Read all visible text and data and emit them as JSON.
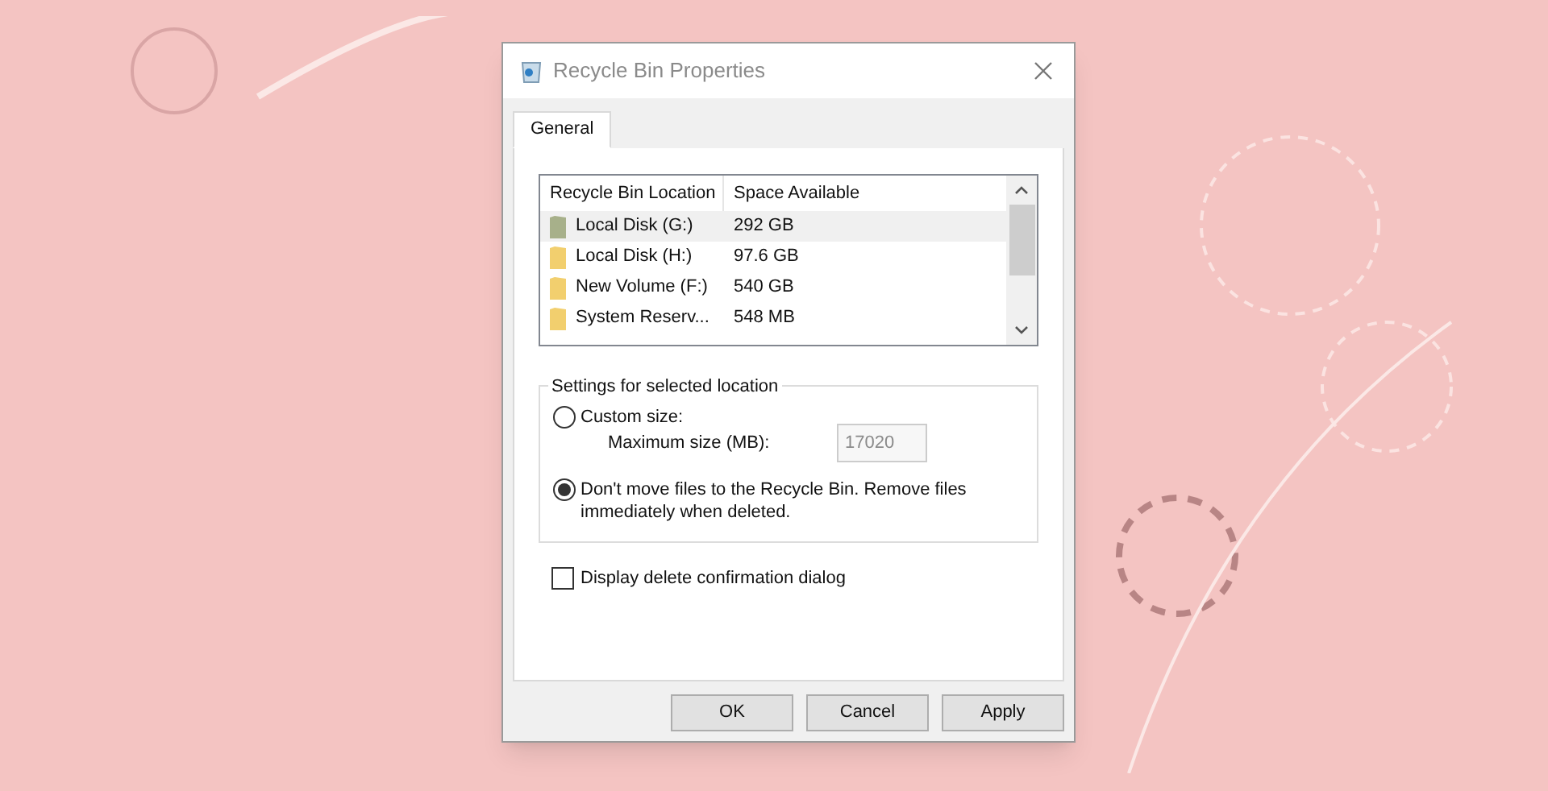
{
  "window": {
    "title": "Recycle Bin Properties"
  },
  "tabs": [
    {
      "label": "General",
      "selected": true
    }
  ],
  "locations": {
    "columns": [
      "Recycle Bin Location",
      "Space Available"
    ],
    "rows": [
      {
        "location": "Local Disk (G:)",
        "space": "292 GB",
        "selected": true
      },
      {
        "location": "Local Disk (H:)",
        "space": "97.6 GB",
        "selected": false
      },
      {
        "location": "New Volume (F:)",
        "space": "540 GB",
        "selected": false
      },
      {
        "location": "System Reserv...",
        "space": "548 MB",
        "selected": false
      }
    ]
  },
  "settings": {
    "title": "Settings for selected location",
    "options": [
      {
        "kind": "custom",
        "label": "Custom size:",
        "selected": false,
        "size_field": {
          "label": "Maximum size (MB):",
          "value": "17020",
          "disabled": true
        }
      },
      {
        "kind": "plain",
        "label": "Don't move files to the Recycle Bin. Remove files immediately when deleted.",
        "selected": true
      }
    ]
  },
  "confirm": {
    "label": "Display delete confirmation dialog",
    "checked": false
  },
  "buttons": [
    "OK",
    "Cancel",
    "Apply"
  ]
}
